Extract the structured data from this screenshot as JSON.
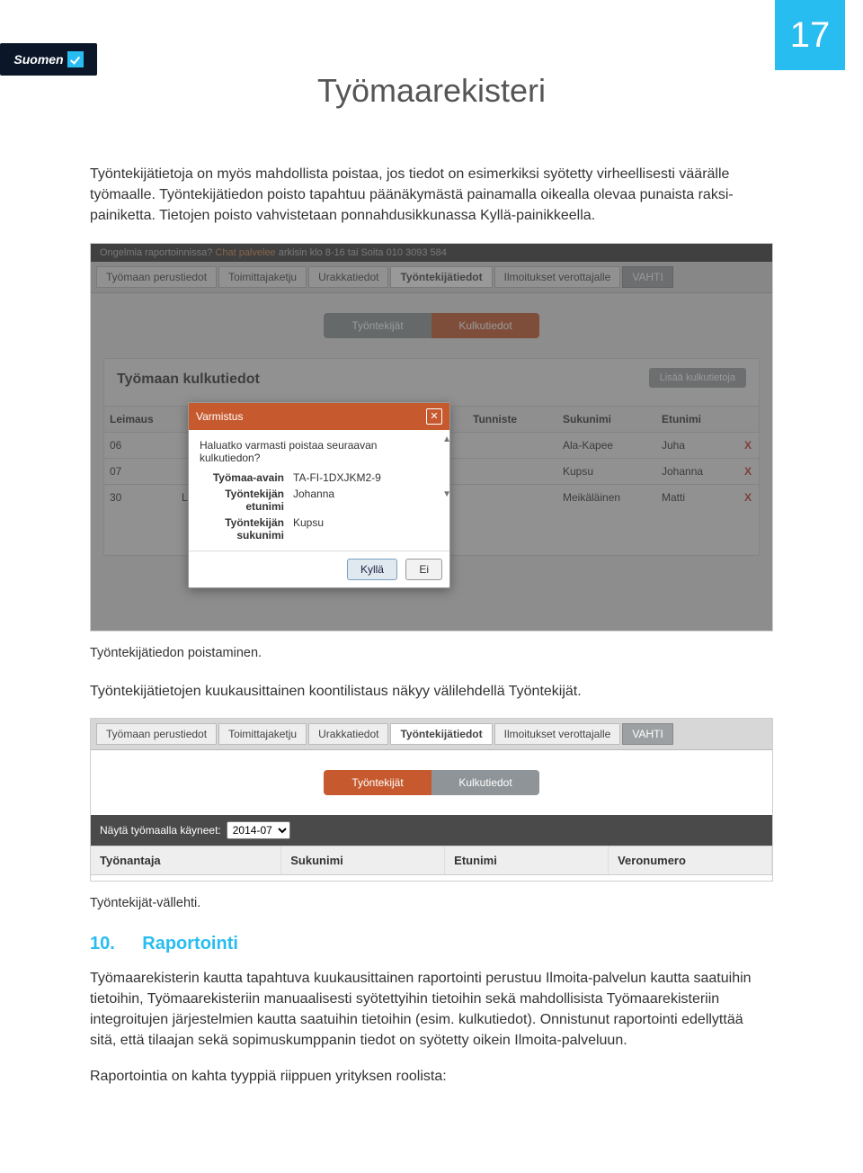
{
  "page_number": "17",
  "logo_text": "Suomen",
  "doc_title": "Työmaarekisteri",
  "para1": "Työntekijätietoja on myös mahdollista poistaa, jos tiedot on esimerkiksi syötetty virheellisesti väärälle työmaalle. Työntekijätiedon poisto tapahtuu päänäkymästä painamalla oikealla olevaa punaista raksi-painiketta. Tietojen poisto vahvistetaan ponnahdusikkunassa Kyllä-painikkeella.",
  "shot1": {
    "topbar_prefix": "Ongelmia raportoinnissa? ",
    "topbar_link": "Chat palvelee",
    "topbar_suffix": " arkisin klo 8-16 tai Soita 010 3093 584",
    "tabs": [
      "Työmaan perustiedot",
      "Toimittajaketju",
      "Urakkatiedot",
      "Työntekijätiedot",
      "Ilmoitukset verottajalle",
      "VAHTI"
    ],
    "active_tab_index": 3,
    "seg_left": "Työntekijät",
    "seg_right": "Kulkutiedot",
    "panel_title": "Työmaan kulkutiedot",
    "add_btn": "Lisää kulkutietoja",
    "headers": [
      "Leimaus",
      "",
      "",
      "Tunniste",
      "Sukunimi",
      "Etunimi",
      ""
    ],
    "rows": [
      {
        "c0": "06",
        "c1": "",
        "c2": "",
        "tun": "",
        "suku": "Ala-Kapee",
        "etu": "Juha"
      },
      {
        "c0": "07",
        "c1": "",
        "c2": "",
        "tun": "",
        "suku": "Kupsu",
        "etu": "Johanna"
      },
      {
        "c0": "30",
        "c1": "Lei",
        "c2": "",
        "tun": "",
        "suku": "Meikäläinen",
        "etu": "Matti"
      }
    ],
    "modal": {
      "title": "Varmistus",
      "question": "Haluatko varmasti poistaa seuraavan kulkutiedon?",
      "fields": [
        {
          "k": "Työmaa-avain",
          "v": "TA-FI-1DXJKM2-9"
        },
        {
          "k": "Työntekijän etunimi",
          "v": "Johanna"
        },
        {
          "k": "Työntekijän sukunimi",
          "v": "Kupsu"
        }
      ],
      "yes": "Kyllä",
      "no": "Ei"
    }
  },
  "caption1": "Työntekijätiedon poistaminen.",
  "para2": "Työntekijätietojen kuukausittainen koontilistaus näkyy välilehdellä Työntekijät.",
  "shot2": {
    "tabs": [
      "Työmaan perustiedot",
      "Toimittajaketju",
      "Urakkatiedot",
      "Työntekijätiedot",
      "Ilmoitukset verottajalle",
      "VAHTI"
    ],
    "active_tab_index": 3,
    "seg_left": "Työntekijät",
    "seg_right": "Kulkutiedot",
    "filter_label": "Näytä työmaalla käyneet:",
    "filter_value": "2014-07",
    "headers": [
      "Työnantaja",
      "Sukunimi",
      "Etunimi",
      "Veronumero"
    ]
  },
  "caption2": "Työntekijät-vällehti.",
  "section": {
    "num": "10.",
    "title": "Raportointi"
  },
  "para3": "Työmaarekisterin kautta tapahtuva kuukausittainen raportointi perustuu Ilmoita-palvelun kautta saatuihin tietoihin, Työmaarekisteriin manuaalisesti syötettyihin tietoihin sekä mahdollisista Työmaarekisteriin integroitujen järjestelmien kautta saatuihin tietoihin (esim. kulkutiedot). Onnistunut raportointi edellyttää sitä, että tilaajan sekä sopimuskumppanin tiedot on syötetty oikein Ilmoita-palveluun.",
  "para4": "Raportointia on kahta tyyppiä riippuen yrityksen roolista:"
}
